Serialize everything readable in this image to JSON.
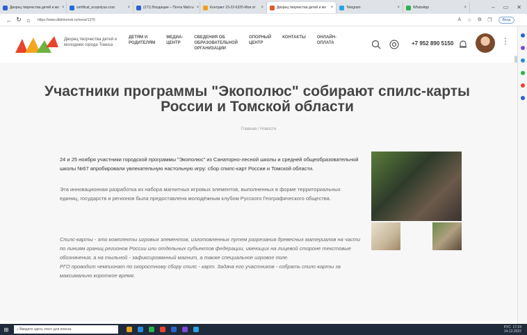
{
  "browser": {
    "tabs": [
      {
        "title": "Дворец творчества детей и мо",
        "color": "#2a62c9",
        "active": false
      },
      {
        "title": "certificat_ecopolyus.cosc",
        "color": "#1e6fd9",
        "active": false
      },
      {
        "title": "(271) Входящие – Почта Mail.ru",
        "color": "#2a62c9",
        "active": false
      },
      {
        "title": "Контракт 23-22-6325-Моя от",
        "color": "#f0a020",
        "active": false
      },
      {
        "title": "Дворец творчества детей и мо",
        "color": "#e8552a",
        "active": true
      },
      {
        "title": "Telegram",
        "color": "#2aa3e0",
        "active": false
      },
      {
        "title": "WhatsApp",
        "color": "#2bb24a",
        "active": false
      }
    ],
    "url": "https://www.dtdmtomsk.ru/news/1376",
    "sync_label": "Вход",
    "window_controls": [
      "–",
      "▭",
      "✕"
    ]
  },
  "site": {
    "logo_text": "Дворец творчества детей и молодежи города Томска",
    "menu": [
      "ДЕТЯМ И\nРОДИТЕЛЯМ",
      "МЕДИА-\nЦЕНТР",
      "СВЕДЕНИЯ ОБ\nОБРАЗОВАТЕЛЬНОЙ\nОРГАНИЗАЦИИ",
      "ОПОРНЫЙ\nЦЕНТР",
      "КОНТАКТЫ",
      "ОНЛАЙН-\nОПЛАТА"
    ],
    "phone": "+7 952 890 5150",
    "icons": [
      "search-icon",
      "eye-icon",
      "bell-icon"
    ]
  },
  "article": {
    "title": "Участники программы \"Экополюс\" собирают спилс-карты России и Томской области",
    "breadcrumb": "Главная / Новости",
    "para1": "24 и 25 ноября участники городской программы \"Экополюс\" из Санаторно-лесной школы и средней общеобразовательной школы №67 апробировали увлекательную настольную игру: сбор спилс-карт России и Томской области.",
    "para2": "Эта инновационная разработка из набора магнитных игровых элементов, выполненных в форме территориальных единиц, государств и регионов была предоставлена молодёжным клубом Русского Географического общества.",
    "para3a": "Спилс-карты - это комплекты игровых элементов, изготовленных путем разрезания древесных материалов на части по линиям границ регионов России или отдельных субъектов федерации, имеющих на лицевой стороне текстовые обозначения, а на тыльной - зафиксированный магнит, а также специальное игровое поле.",
    "para3b": "РГО проводит чемпионат по скоростному сбору спилс - карт. Задача его участников - собрать спилс-карты за максимально короткое время."
  },
  "taskbar": {
    "search_placeholder": "Введите здесь текст для поиска",
    "time": "17:24",
    "date": "14.12.2022",
    "lang": "РУС"
  },
  "colors": {
    "content_bg": "#f7f7f7",
    "title": "#444444",
    "taskbar": "#1f2a3a"
  }
}
